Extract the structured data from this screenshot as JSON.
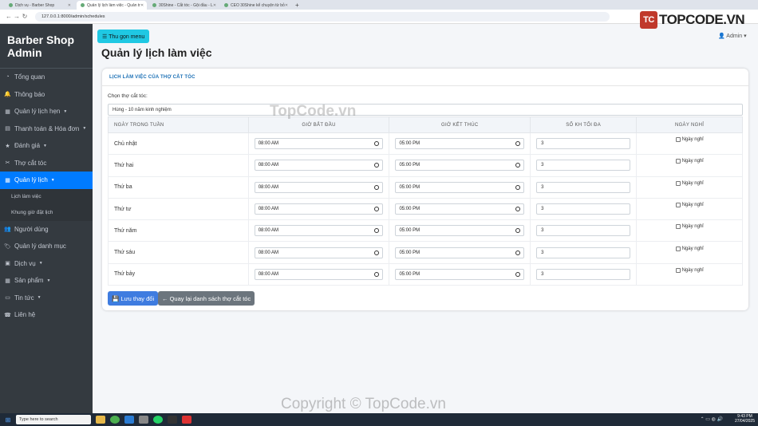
{
  "browser": {
    "tabs": [
      {
        "title": "Dịch vụ - Barber Shop",
        "active": false
      },
      {
        "title": "Quản lý lịch làm việc - Quản tr",
        "active": true
      },
      {
        "title": "30Shine - Cắt tóc - Gội đầu - L",
        "active": false
      },
      {
        "title": "CEO 30Shine kể chuyện từ bỏ",
        "active": false
      }
    ],
    "new_tab": "+",
    "url": "127.0.0.1:8000/admin/schedules"
  },
  "logo": {
    "mark": "TC",
    "text": "TOPCODE.VN"
  },
  "sidebar": {
    "brand": "Barber Shop Admin",
    "items": [
      {
        "label": "Tổng quan",
        "icon": "dashboard-icon",
        "glyph": "◔",
        "caret": false,
        "active": false
      },
      {
        "label": "Thông báo",
        "icon": "bell-icon",
        "glyph": "🔔",
        "caret": false,
        "active": false
      },
      {
        "label": "Quản lý lịch hẹn",
        "icon": "calendar-icon",
        "glyph": "▦",
        "caret": true,
        "active": false
      },
      {
        "label": "Thanh toán & Hóa đơn",
        "icon": "receipt-icon",
        "glyph": "▤",
        "caret": true,
        "active": false
      },
      {
        "label": "Đánh giá",
        "icon": "star-icon",
        "glyph": "★",
        "caret": true,
        "active": false
      },
      {
        "label": "Thợ cắt tóc",
        "icon": "scissors-icon",
        "glyph": "✂",
        "caret": false,
        "active": false
      },
      {
        "label": "Quản lý lịch",
        "icon": "calendar-icon",
        "glyph": "▦",
        "caret": true,
        "active": true
      },
      {
        "label": "Người dùng",
        "icon": "users-icon",
        "glyph": "👥",
        "caret": false,
        "active": false
      },
      {
        "label": "Quản lý danh mục",
        "icon": "tags-icon",
        "glyph": "🏷",
        "caret": false,
        "active": false
      },
      {
        "label": "Dịch vụ",
        "icon": "briefcase-icon",
        "glyph": "▣",
        "caret": true,
        "active": false
      },
      {
        "label": "Sản phẩm",
        "icon": "box-icon",
        "glyph": "▦",
        "caret": true,
        "active": false
      },
      {
        "label": "Tin tức",
        "icon": "folder-icon",
        "glyph": "▭",
        "caret": true,
        "active": false
      },
      {
        "label": "Liên hệ",
        "icon": "phone-icon",
        "glyph": "☎",
        "caret": false,
        "active": false
      }
    ],
    "subitems": [
      "Lịch làm việc",
      "Khung giờ đặt lịch"
    ]
  },
  "header": {
    "collapse_label": "☰ Thu gọn menu",
    "user": "Admin",
    "title": "Quản lý lịch làm việc"
  },
  "card": {
    "header": "LỊCH LÀM VIỆC CỦA THỢ CẮT TÓC",
    "select_label": "Chọn thợ cắt tóc:",
    "select_value": "Hùng - 10 năm kinh nghiệm",
    "columns": [
      "NGÀY TRONG TUẦN",
      "GIỜ BẮT ĐẦU",
      "GIỜ KẾT THÚC",
      "SỐ KH TỐI ĐA",
      "NGÀY NGHỈ"
    ],
    "rows": [
      {
        "day": "Chủ nhật",
        "start": "08:00 AM",
        "end": "05:00 PM",
        "max": "3",
        "off_label": "Ngày nghỉ"
      },
      {
        "day": "Thứ hai",
        "start": "08:00 AM",
        "end": "05:00 PM",
        "max": "3",
        "off_label": "Ngày nghỉ"
      },
      {
        "day": "Thứ ba",
        "start": "08:00 AM",
        "end": "05:00 PM",
        "max": "3",
        "off_label": "Ngày nghỉ"
      },
      {
        "day": "Thứ tư",
        "start": "08:00 AM",
        "end": "05:00 PM",
        "max": "3",
        "off_label": "Ngày nghỉ"
      },
      {
        "day": "Thứ năm",
        "start": "08:00 AM",
        "end": "05:00 PM",
        "max": "3",
        "off_label": "Ngày nghỉ"
      },
      {
        "day": "Thứ sáu",
        "start": "08:00 AM",
        "end": "05:00 PM",
        "max": "3",
        "off_label": "Ngày nghỉ"
      },
      {
        "day": "Thứ bảy",
        "start": "08:00 AM",
        "end": "05:00 PM",
        "max": "3",
        "off_label": "Ngày nghỉ"
      }
    ],
    "save_label": "💾 Lưu thay đổi",
    "back_label": "← Quay lại danh sách thợ cắt tóc"
  },
  "watermarks": [
    "TopCode.vn",
    "Copyright © TopCode.vn"
  ],
  "taskbar": {
    "search_placeholder": "Type here to search",
    "time": "9:43 PM",
    "date": "27/04/2025"
  },
  "colors": {
    "sidebar": "#343a40",
    "accent": "#007bff",
    "collapse": "#1fc8e3",
    "save": "#3f7ce0",
    "back": "#6c757d"
  }
}
